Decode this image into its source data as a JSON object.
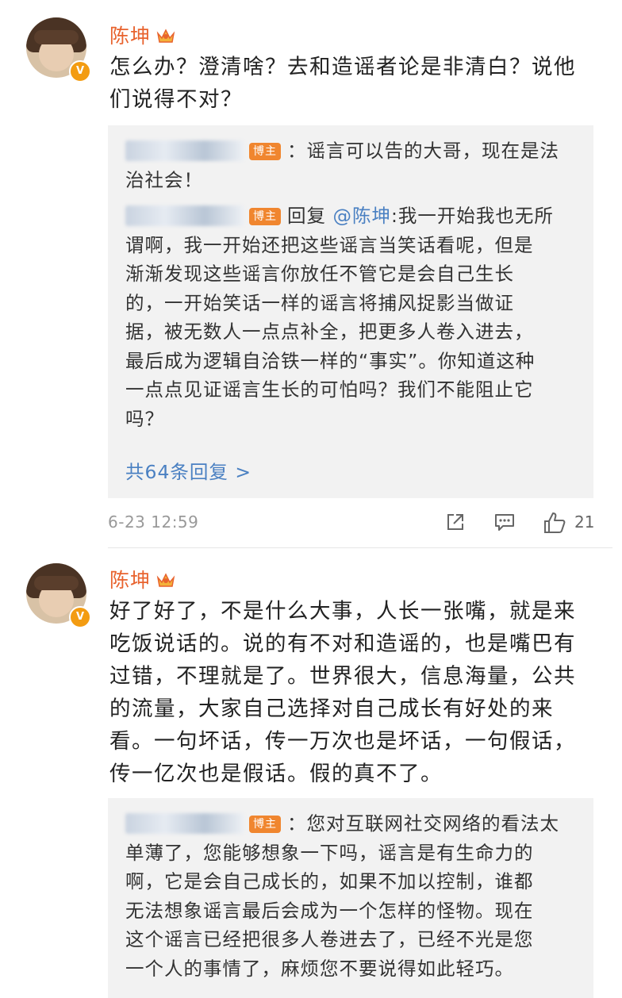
{
  "comments": [
    {
      "author": "陈坤",
      "avatar_badge": "V",
      "text_lines": [
        "怎么办？澄清啥？去和造谣者论是非清白？说他",
        "们说得不对？"
      ],
      "replies": {
        "first": {
          "host_tag": "博主",
          "text_lines": [
            "：谣言可以告的大哥，现在是法",
            "治社会！"
          ]
        },
        "second": {
          "host_tag": "博主",
          "reply_prefix": "回复",
          "mention": "@陈坤",
          "text_lines": [
            ":我一开始我也无所",
            "谓啊，我一开始还把这些谣言当笑话看呢，但是",
            "渐渐发现这些谣言你放任不管它是会自己生长",
            "的，一开始笑话一样的谣言将捕风捉影当做证",
            "据，被无数人一点点补全，把更多人卷入进去，",
            "最后成为逻辑自洽铁一样的“事实”。你知道这种",
            "一点点见证谣言生长的可怕吗？我们不能阻止它",
            "吗？"
          ]
        },
        "more_label": "共64条回复 >"
      },
      "timestamp": "6-23 12:59",
      "like_count": "21",
      "icons": {
        "share": "share-icon",
        "comment": "comment-icon",
        "like": "thumbs-up-icon"
      }
    },
    {
      "author": "陈坤",
      "avatar_badge": "V",
      "text_lines": [
        "好了好了，不是什么大事，人长一张嘴，就是来",
        "吃饭说话的。说的有不对和造谣的，也是嘴巴有",
        "过错，不理就是了。世界很大，信息海量，公共",
        "的流量，大家自己选择对自己成长有好处的来",
        "看。一句坏话，传一万次也是坏话，一句假话，",
        "传一亿次也是假话。假的真不了。"
      ],
      "replies": {
        "first": {
          "host_tag": "博主",
          "text_lines": [
            "：您对互联网社交网络的看法太",
            "单薄了，您能够想象一下吗，谣言是有生命力的",
            "啊，它是会自己成长的，如果不加以控制，谁都",
            "无法想象谣言最后会成为一个怎样的怪物。现在",
            "这个谣言已经把很多人卷进去了，已经不光是您",
            "一个人的事情了，麻烦您不要说得如此轻巧。"
          ]
        }
      }
    }
  ],
  "colors": {
    "name": "#e8632e",
    "link": "#4a80c2",
    "host_tag": "#f0862f",
    "reply_bg": "#f2f2f2"
  }
}
